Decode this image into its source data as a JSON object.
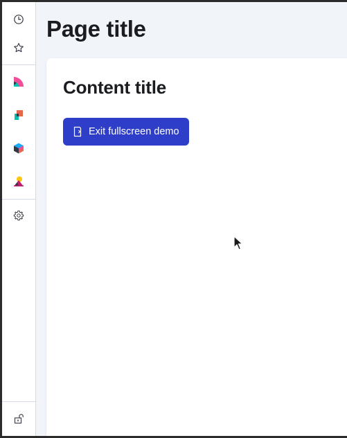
{
  "page": {
    "title": "Page title"
  },
  "content": {
    "title": "Content title",
    "exit_button_label": "Exit fullscreen demo"
  },
  "sidebar": {
    "top_items": [
      {
        "name": "recently-viewed",
        "icon": "clock-icon"
      },
      {
        "name": "favorites",
        "icon": "star-icon"
      }
    ],
    "app_items": [
      {
        "name": "analytics-app",
        "icon": "analytics-logo-icon"
      },
      {
        "name": "observability-app",
        "icon": "observability-logo-icon"
      },
      {
        "name": "security-app",
        "icon": "security-logo-icon"
      },
      {
        "name": "management-app",
        "icon": "management-logo-icon"
      }
    ],
    "bottom_items": [
      {
        "name": "settings",
        "icon": "gear-icon"
      }
    ],
    "footer_items": [
      {
        "name": "dock-toggle",
        "icon": "lock-open-icon"
      }
    ]
  },
  "colors": {
    "primary": "#2e3ec9",
    "page_bg": "#f1f5fa",
    "border": "#d3dae6",
    "text": "#1a1c21",
    "logo_pink": "#f04e98",
    "logo_teal": "#00bfb3",
    "logo_red": "#e7664c",
    "logo_blue": "#1ba9f5",
    "logo_navy": "#343741",
    "logo_yellow": "#fec514",
    "logo_magenta": "#bc1e70"
  }
}
